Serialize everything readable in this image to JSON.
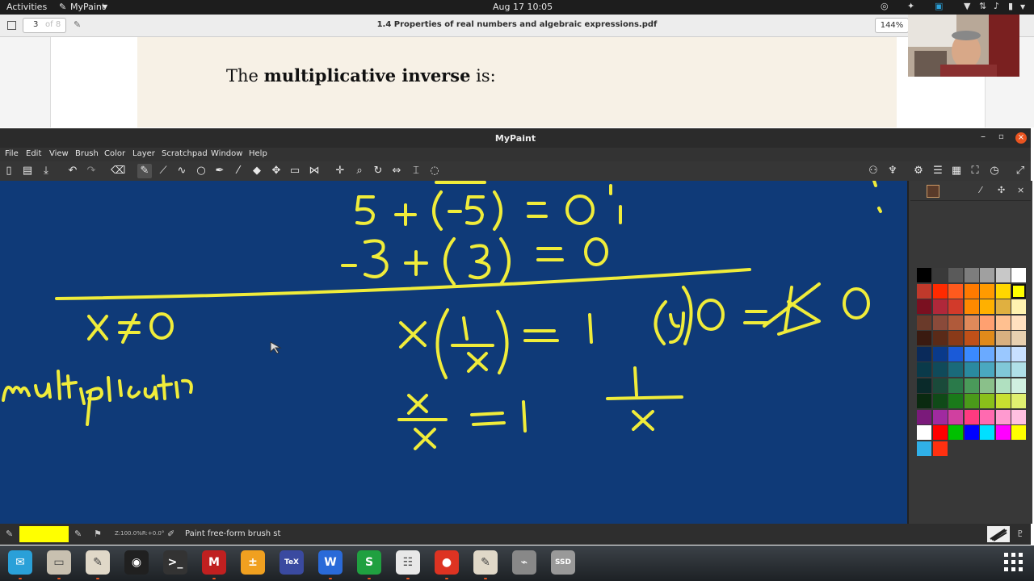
{
  "topbar": {
    "activities": "Activities",
    "app_menu": "MyPaint",
    "clock": "Aug 17  10:05"
  },
  "pdf_viewer": {
    "page_number": "3",
    "page_total": "of 8",
    "document_title": "1.4 Properties of real numbers and algebraic expressions.pdf",
    "zoom": "144%",
    "text_before": "The ",
    "text_bold": "multiplicative inverse",
    "text_after": " is:"
  },
  "mypaint": {
    "window_title": "MyPaint",
    "menu": [
      "File",
      "Edit",
      "View",
      "Brush",
      "Color",
      "Layer",
      "Scratchpad",
      "Window",
      "Help"
    ],
    "toolbar_icons": [
      "new-icon",
      "open-icon",
      "save-icon",
      "undo-icon",
      "redo-icon",
      "eraser-icon",
      "brush-icon",
      "lines-icon",
      "curve-icon",
      "ellipse-icon",
      "inking-icon",
      "color-picker-icon",
      "fill-icon",
      "pan-icon",
      "frame-icon",
      "symmetry-icon",
      "move-icon",
      "zoom-icon",
      "rotate-icon",
      "flip-icon",
      "fit-icon",
      "reset-icon"
    ],
    "canvas_color": "#0f3a78",
    "ink_color": "#f0ec3a",
    "status": {
      "zoom_info": "Z:100.0%R:+0.0°",
      "brush_text": "Paint free-form brush st"
    },
    "current_color": "#ffff00"
  },
  "palette": [
    [
      "#000000",
      "#3a3a3a",
      "#5a5a5a",
      "#7d7d7d",
      "#a0a0a0",
      "#c8c8c8",
      "#ffffff"
    ],
    [
      "#c0392b",
      "#ff2a00",
      "#ff5a1e",
      "#ff7a00",
      "#ff9a00",
      "#ffd600",
      "#ffff00"
    ],
    [
      "#7a1020",
      "#b0283a",
      "#d23a2a",
      "#ff8a00",
      "#ffb000",
      "#e0b040",
      "#fff2b0"
    ],
    [
      "#6a3a2a",
      "#8a4a3a",
      "#b05a3a",
      "#e08a5a",
      "#ffa070",
      "#ffc090",
      "#ffe0c0"
    ],
    [
      "#3a1a10",
      "#5a2a18",
      "#8a3a18",
      "#c05018",
      "#e08a1a",
      "#d8b080",
      "#e8d0b0"
    ],
    [
      "#0a2a5a",
      "#0a3a8a",
      "#1a5ad8",
      "#3a8aff",
      "#6aaaff",
      "#9ac8ff",
      "#c8e0ff"
    ],
    [
      "#0a3a4a",
      "#104a5a",
      "#1a6a7a",
      "#2a8aa0",
      "#4aa8c0",
      "#80c8d8",
      "#b0e0e8"
    ],
    [
      "#0a2a2a",
      "#1a4a3a",
      "#2a7a4a",
      "#4a9a5a",
      "#8ac08a",
      "#b0e0c0",
      "#d0f0e0"
    ],
    [
      "#0a2a10",
      "#104a18",
      "#1a7a1a",
      "#4a9a1a",
      "#8ac01a",
      "#c8e030",
      "#e0f070"
    ],
    [
      "#7a1a7a",
      "#a02aa0",
      "#d040a0",
      "#ff3a80",
      "#ff6ab0",
      "#ff9ad0",
      "#ffc0e0"
    ],
    [
      "#ffffff",
      "#ff0000",
      "#00c000",
      "#0000ff",
      "#00e0ff",
      "#ff00ff",
      "#ffff00"
    ],
    [
      "#30b0e8",
      "#ff3010"
    ]
  ],
  "dock": [
    {
      "name": "mail-app",
      "color": "#2aa0d8",
      "glyph": "✉"
    },
    {
      "name": "files-app",
      "color": "#c8c0b0",
      "glyph": "▭"
    },
    {
      "name": "pencil-app",
      "color": "#e0d8c8",
      "glyph": "✎"
    },
    {
      "name": "obs-app",
      "color": "#202020",
      "glyph": "◉"
    },
    {
      "name": "terminal-app",
      "color": "#333333",
      "glyph": ">_"
    },
    {
      "name": "maple-app",
      "color": "#c02020",
      "glyph": "M"
    },
    {
      "name": "calculator-app",
      "color": "#f0a020",
      "glyph": "±"
    },
    {
      "name": "texmaker-app",
      "color": "#3a4aa0",
      "glyph": "TeX"
    },
    {
      "name": "writer-app",
      "color": "#2a6ad8",
      "glyph": "W"
    },
    {
      "name": "spreadsheet-app",
      "color": "#20a040",
      "glyph": "S"
    },
    {
      "name": "document-viewer-app",
      "color": "#e8e8e8",
      "glyph": "☷"
    },
    {
      "name": "chrome-app",
      "color": "#dd3322",
      "glyph": "●"
    },
    {
      "name": "mypaint-app",
      "color": "#e0d8c8",
      "glyph": "✎"
    },
    {
      "name": "usb-app",
      "color": "#888888",
      "glyph": "⌁"
    },
    {
      "name": "ssd-app",
      "color": "#999999",
      "glyph": "SSD"
    }
  ]
}
